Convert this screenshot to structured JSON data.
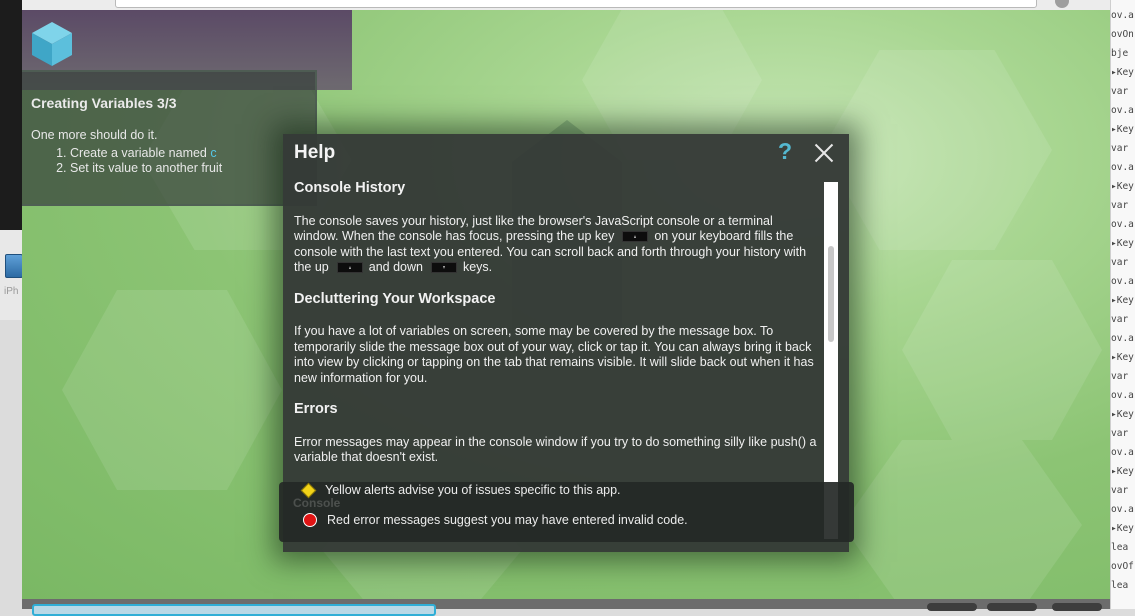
{
  "instructions": {
    "title": "Creating Variables 3/3",
    "lede": "One more should do it.",
    "steps": [
      {
        "text": "Create a variable named ",
        "code": "c"
      },
      {
        "text": "Set its value to another fruit"
      }
    ]
  },
  "help": {
    "title": "Help",
    "help_icon": "?",
    "sections": {
      "console_history": {
        "heading": "Console History",
        "text_1": "The console saves your history, just like the browser's JavaScript console or a terminal window. When the console has focus, pressing the up key",
        "text_2": "on your keyboard fills the console with the last text you entered. You can scroll back and forth through your history with the up",
        "text_3": "and down",
        "text_4": "keys."
      },
      "decluttering": {
        "heading": "Decluttering Your Workspace",
        "text": "If you have a lot of variables on screen, some may be covered by the message box. To temporarily slide the message box out of your way, click or tap it. You can always bring it back into view by clicking or tapping on the tab that remains visible. It will slide back out when it has new information for you."
      },
      "errors": {
        "heading": "Errors",
        "text": "Error messages may appear in the console window if you try to do something silly like push() a variable that doesn't exist."
      }
    }
  },
  "alerts": {
    "ghost_text": "Console",
    "yellow": "Yellow alerts advise you of issues specific to this app.",
    "red": "Red error messages suggest you may have entered invalid code."
  },
  "left_strip": {
    "app_label": "iPh"
  },
  "right_strip": {
    "lines": [
      "ov.a",
      "ovOn",
      "bje",
      "Key",
      "var",
      "ov.a",
      "Key",
      "var",
      "ov.a",
      "Key",
      "var",
      "ov.a",
      "Key",
      "var",
      "ov.a",
      "Key",
      "var",
      "ov.a",
      "Key",
      "var",
      "ov.a",
      "Key",
      "var",
      "ov.a",
      "Key",
      "var",
      "ov.a",
      "Key",
      "lea",
      "ovOf",
      "lea"
    ]
  },
  "colors": {
    "accent": "#55c7e6",
    "help_icon": "#54b8d0",
    "yellow_alert": "#f2d318",
    "red_alert": "#e01414"
  }
}
